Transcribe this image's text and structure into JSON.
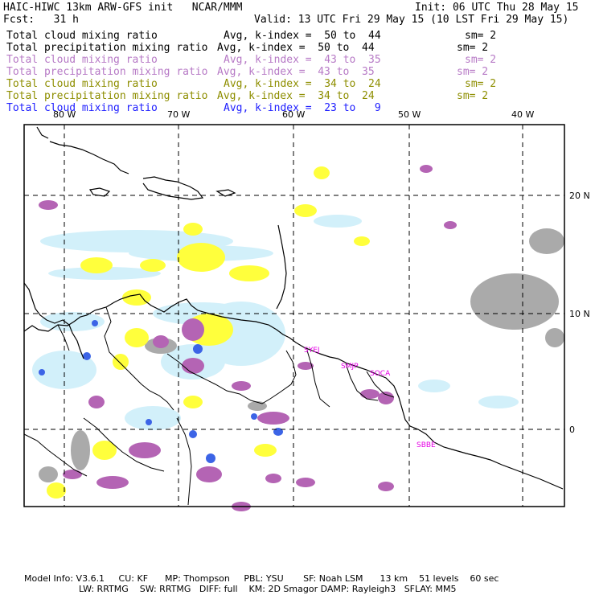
{
  "header": {
    "title": "HAIC-HIWC 13km ARW-GFS init   NCAR/MMM",
    "init": "Init: 06 UTC Thu 28 May 15",
    "fcst": "Fcst:   31 h",
    "valid": "Valid: 13 UTC Fri 29 May 15 (10 LST Fri 29 May 15)"
  },
  "legend": [
    {
      "field": "Total cloud mixing ratio",
      "range": "Avg, k-index =  50 to  44",
      "sm": "sm= 2",
      "color": "#000000"
    },
    {
      "field": "Total precipitation mixing ratio",
      "range": "Avg, k-index =  50 to  44",
      "sm": "sm= 2",
      "color": "#000000"
    },
    {
      "field": "Total cloud mixing ratio",
      "range": "Avg, k-index =  43 to  35",
      "sm": "sm= 2",
      "color": "#b77ac6"
    },
    {
      "field": "Total precipitation mixing ratio",
      "range": "Avg, k-index =  43 to  35",
      "sm": "sm= 2",
      "color": "#b77ac6"
    },
    {
      "field": "Total cloud mixing ratio",
      "range": "Avg, k-index =  34 to  24",
      "sm": "sm= 2",
      "color": "#8e8e00"
    },
    {
      "field": "Total precipitation mixing ratio",
      "range": "Avg, k-index =  34 to  24",
      "sm": "sm= 2",
      "color": "#8e8e00"
    },
    {
      "field": "Total cloud mixing ratio",
      "range": "Avg, k-index =  23 to   9",
      "sm": "",
      "color": "#2020ff"
    }
  ],
  "map": {
    "lon_labels": [
      "80 W",
      "70 W",
      "60 W",
      "50 W",
      "40 W"
    ],
    "lat_labels": [
      "20 N",
      "10 N",
      "0"
    ],
    "stations": [
      "SYEJ",
      "SMJP",
      "SOCA",
      "SBBE"
    ],
    "colors": {
      "yellow": "#ffff3c",
      "cyan": "#d2f0fa",
      "purple": "#b464b4",
      "gray": "#aaaaaa",
      "blue": "#3c64e6",
      "station": "#e600e6"
    }
  },
  "footer": {
    "line1": "Model Info: V3.6.1     CU: KF      MP: Thompson     PBL: YSU       SF: Noah LSM      13 km    51 levels    60 sec",
    "line2": "LW: RRTMG    SW: RRTMG   DIFF: full    KM: 2D Smagor DAMP: Rayleigh3   SFLAY: MM5"
  }
}
